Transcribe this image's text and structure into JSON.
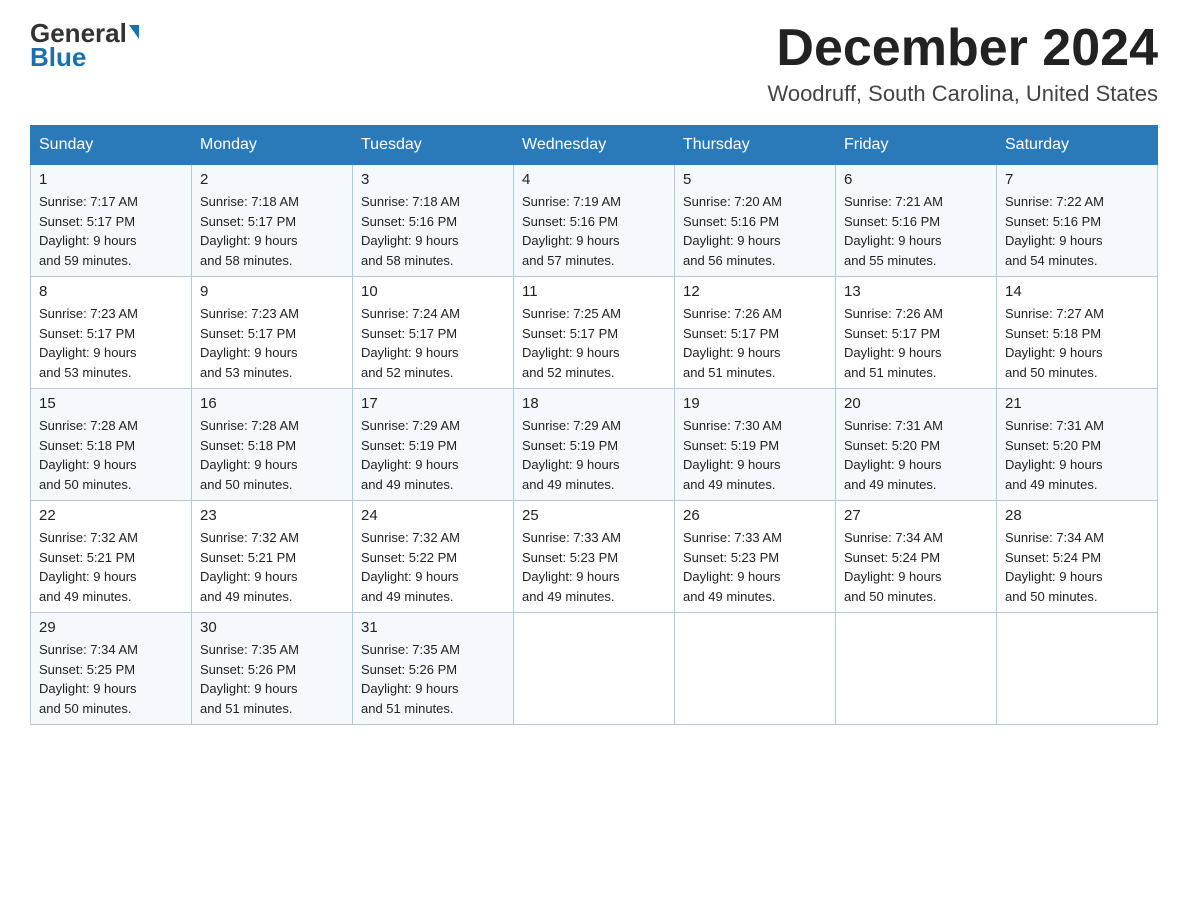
{
  "header": {
    "logo_general": "General",
    "logo_blue": "Blue",
    "month_title": "December 2024",
    "location": "Woodruff, South Carolina, United States"
  },
  "days_of_week": [
    "Sunday",
    "Monday",
    "Tuesday",
    "Wednesday",
    "Thursday",
    "Friday",
    "Saturday"
  ],
  "weeks": [
    [
      {
        "day": "1",
        "sunrise": "7:17 AM",
        "sunset": "5:17 PM",
        "daylight": "9 hours and 59 minutes."
      },
      {
        "day": "2",
        "sunrise": "7:18 AM",
        "sunset": "5:17 PM",
        "daylight": "9 hours and 58 minutes."
      },
      {
        "day": "3",
        "sunrise": "7:18 AM",
        "sunset": "5:16 PM",
        "daylight": "9 hours and 58 minutes."
      },
      {
        "day": "4",
        "sunrise": "7:19 AM",
        "sunset": "5:16 PM",
        "daylight": "9 hours and 57 minutes."
      },
      {
        "day": "5",
        "sunrise": "7:20 AM",
        "sunset": "5:16 PM",
        "daylight": "9 hours and 56 minutes."
      },
      {
        "day": "6",
        "sunrise": "7:21 AM",
        "sunset": "5:16 PM",
        "daylight": "9 hours and 55 minutes."
      },
      {
        "day": "7",
        "sunrise": "7:22 AM",
        "sunset": "5:16 PM",
        "daylight": "9 hours and 54 minutes."
      }
    ],
    [
      {
        "day": "8",
        "sunrise": "7:23 AM",
        "sunset": "5:17 PM",
        "daylight": "9 hours and 53 minutes."
      },
      {
        "day": "9",
        "sunrise": "7:23 AM",
        "sunset": "5:17 PM",
        "daylight": "9 hours and 53 minutes."
      },
      {
        "day": "10",
        "sunrise": "7:24 AM",
        "sunset": "5:17 PM",
        "daylight": "9 hours and 52 minutes."
      },
      {
        "day": "11",
        "sunrise": "7:25 AM",
        "sunset": "5:17 PM",
        "daylight": "9 hours and 52 minutes."
      },
      {
        "day": "12",
        "sunrise": "7:26 AM",
        "sunset": "5:17 PM",
        "daylight": "9 hours and 51 minutes."
      },
      {
        "day": "13",
        "sunrise": "7:26 AM",
        "sunset": "5:17 PM",
        "daylight": "9 hours and 51 minutes."
      },
      {
        "day": "14",
        "sunrise": "7:27 AM",
        "sunset": "5:18 PM",
        "daylight": "9 hours and 50 minutes."
      }
    ],
    [
      {
        "day": "15",
        "sunrise": "7:28 AM",
        "sunset": "5:18 PM",
        "daylight": "9 hours and 50 minutes."
      },
      {
        "day": "16",
        "sunrise": "7:28 AM",
        "sunset": "5:18 PM",
        "daylight": "9 hours and 50 minutes."
      },
      {
        "day": "17",
        "sunrise": "7:29 AM",
        "sunset": "5:19 PM",
        "daylight": "9 hours and 49 minutes."
      },
      {
        "day": "18",
        "sunrise": "7:29 AM",
        "sunset": "5:19 PM",
        "daylight": "9 hours and 49 minutes."
      },
      {
        "day": "19",
        "sunrise": "7:30 AM",
        "sunset": "5:19 PM",
        "daylight": "9 hours and 49 minutes."
      },
      {
        "day": "20",
        "sunrise": "7:31 AM",
        "sunset": "5:20 PM",
        "daylight": "9 hours and 49 minutes."
      },
      {
        "day": "21",
        "sunrise": "7:31 AM",
        "sunset": "5:20 PM",
        "daylight": "9 hours and 49 minutes."
      }
    ],
    [
      {
        "day": "22",
        "sunrise": "7:32 AM",
        "sunset": "5:21 PM",
        "daylight": "9 hours and 49 minutes."
      },
      {
        "day": "23",
        "sunrise": "7:32 AM",
        "sunset": "5:21 PM",
        "daylight": "9 hours and 49 minutes."
      },
      {
        "day": "24",
        "sunrise": "7:32 AM",
        "sunset": "5:22 PM",
        "daylight": "9 hours and 49 minutes."
      },
      {
        "day": "25",
        "sunrise": "7:33 AM",
        "sunset": "5:23 PM",
        "daylight": "9 hours and 49 minutes."
      },
      {
        "day": "26",
        "sunrise": "7:33 AM",
        "sunset": "5:23 PM",
        "daylight": "9 hours and 49 minutes."
      },
      {
        "day": "27",
        "sunrise": "7:34 AM",
        "sunset": "5:24 PM",
        "daylight": "9 hours and 50 minutes."
      },
      {
        "day": "28",
        "sunrise": "7:34 AM",
        "sunset": "5:24 PM",
        "daylight": "9 hours and 50 minutes."
      }
    ],
    [
      {
        "day": "29",
        "sunrise": "7:34 AM",
        "sunset": "5:25 PM",
        "daylight": "9 hours and 50 minutes."
      },
      {
        "day": "30",
        "sunrise": "7:35 AM",
        "sunset": "5:26 PM",
        "daylight": "9 hours and 51 minutes."
      },
      {
        "day": "31",
        "sunrise": "7:35 AM",
        "sunset": "5:26 PM",
        "daylight": "9 hours and 51 minutes."
      },
      null,
      null,
      null,
      null
    ]
  ],
  "sunrise_label": "Sunrise:",
  "sunset_label": "Sunset:",
  "daylight_label": "Daylight:"
}
